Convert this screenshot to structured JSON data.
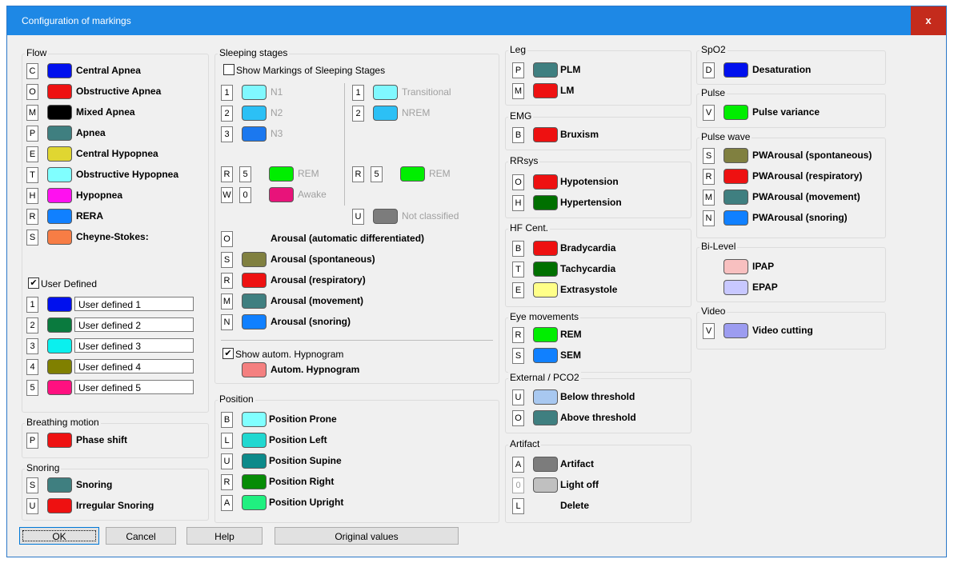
{
  "window": {
    "title": "Configuration of markings",
    "close": "x"
  },
  "colors": {
    "blue": "#0010ee",
    "red": "#ee1111",
    "black": "#000000",
    "teal": "#3f7f80",
    "yellow": "#e0d631",
    "lightcyan": "#80ffff",
    "magenta": "#ff10f0",
    "skyblue": "#1080ff",
    "orange": "#f77d45",
    "darkgreen": "#0a7a3e",
    "cyan": "#0af0ee",
    "olive": "#808000",
    "pink": "#ff1080",
    "n1": "#80f8ff",
    "n2": "#2cc0f5",
    "n3": "#1b78ef",
    "green": "#00ee00",
    "deeppink": "#e8137a",
    "gray": "#7c7c7c",
    "khaki": "#808040",
    "salmon": "#f48080",
    "turquoise": "#20d8d0",
    "darkcyan": "#0c8a8a",
    "green2": "#068c06",
    "springgreen": "#20f080",
    "red2": "#ee1111",
    "darkgreen2": "#007000",
    "lightyellow": "#ffff88",
    "lightblue": "#a8c8f0",
    "lightgray": "#c0c0c0",
    "lightpink": "#f8c0c0",
    "lavender": "#c8c8ff",
    "periwinkle": "#9c9cf0"
  },
  "flow": {
    "caption": "Flow",
    "items": [
      {
        "key": "C",
        "label": "Central Apnea",
        "color": "#0010ee"
      },
      {
        "key": "O",
        "label": "Obstructive Apnea",
        "color": "#ee1111"
      },
      {
        "key": "M",
        "label": "Mixed Apnea",
        "color": "#000000"
      },
      {
        "key": "P",
        "label": "Apnea",
        "color": "#3f7f80"
      },
      {
        "key": "E",
        "label": "Central Hypopnea",
        "color": "#e0d631"
      },
      {
        "key": "T",
        "label": "Obstructive Hypopnea",
        "color": "#80ffff"
      },
      {
        "key": "H",
        "label": "Hypopnea",
        "color": "#ff10f0"
      },
      {
        "key": "R",
        "label": "RERA",
        "color": "#1080ff"
      },
      {
        "key": "S",
        "label": "Cheyne-Stokes:",
        "color": "#f77d45"
      }
    ],
    "user_defined_label": "User Defined",
    "user_defined_check": "✔",
    "user_items": [
      {
        "key": "1",
        "value": "User defined 1",
        "color": "#0010ee"
      },
      {
        "key": "2",
        "value": "User defined 2",
        "color": "#0a7a3e"
      },
      {
        "key": "3",
        "value": "User defined 3",
        "color": "#0af0ee"
      },
      {
        "key": "4",
        "value": "User defined 4",
        "color": "#808000"
      },
      {
        "key": "5",
        "value": "User defined 5",
        "color": "#ff1080"
      }
    ]
  },
  "breathing": {
    "caption": "Breathing motion",
    "items": [
      {
        "key": "P",
        "label": "Phase shift",
        "color": "#ee1111"
      }
    ]
  },
  "snoring": {
    "caption": "Snoring",
    "items": [
      {
        "key": "S",
        "label": "Snoring",
        "color": "#3f7f80"
      },
      {
        "key": "U",
        "label": "Irregular Snoring",
        "color": "#ee1111"
      }
    ]
  },
  "sleeping": {
    "caption": "Sleeping stages",
    "show_label": "Show Markings of Sleeping Stages",
    "left": [
      {
        "key": "1",
        "label": "N1",
        "color": "#80f8ff"
      },
      {
        "key": "2",
        "label": "N2",
        "color": "#2cc0f5"
      },
      {
        "key": "3",
        "label": "N3",
        "color": "#1b78ef"
      }
    ],
    "right": [
      {
        "key": "1",
        "label": "Transitional",
        "color": "#80f8ff"
      },
      {
        "key": "2",
        "label": "NREM",
        "color": "#2cc0f5"
      }
    ],
    "rem_left": {
      "key": "R",
      "num": "5",
      "label": "REM",
      "color": "#00ee00"
    },
    "awake": {
      "key": "W",
      "num": "0",
      "label": "Awake",
      "color": "#e8137a"
    },
    "rem_right": {
      "key": "R",
      "num": "5",
      "label": "REM",
      "color": "#00ee00"
    },
    "not_classified": {
      "key": "U",
      "label": "Not classified",
      "color": "#7c7c7c"
    },
    "arousal_auto": {
      "key": "O",
      "label": "Arousal (automatic differentiated)"
    },
    "arousals": [
      {
        "key": "S",
        "label": "Arousal (spontaneous)",
        "color": "#808040"
      },
      {
        "key": "R",
        "label": "Arousal (respiratory)",
        "color": "#ee1111"
      },
      {
        "key": "M",
        "label": "Arousal (movement)",
        "color": "#3f7f80"
      },
      {
        "key": "N",
        "label": "Arousal (snoring)",
        "color": "#1080ff"
      }
    ],
    "hypnogram_show": "Show autom. Hypnogram",
    "hypnogram_check": "✔",
    "hypnogram_label": "Autom. Hypnogram",
    "hypnogram_color": "#f48080"
  },
  "position": {
    "caption": "Position",
    "items": [
      {
        "key": "B",
        "label": "Position Prone",
        "color": "#80ffff"
      },
      {
        "key": "L",
        "label": "Position Left",
        "color": "#20d8d0"
      },
      {
        "key": "U",
        "label": "Position Supine",
        "color": "#0c8a8a"
      },
      {
        "key": "R",
        "label": "Position Right",
        "color": "#068c06"
      },
      {
        "key": "A",
        "label": "Position Upright",
        "color": "#20f080"
      }
    ]
  },
  "leg": {
    "caption": "Leg",
    "items": [
      {
        "key": "P",
        "label": "PLM",
        "color": "#3f7f80"
      },
      {
        "key": "M",
        "label": "LM",
        "color": "#ee1111"
      }
    ]
  },
  "emg": {
    "caption": "EMG",
    "items": [
      {
        "key": "B",
        "label": "Bruxism",
        "color": "#ee1111"
      }
    ]
  },
  "rrsys": {
    "caption": "RRsys",
    "items": [
      {
        "key": "O",
        "label": "Hypotension",
        "color": "#ee1111"
      },
      {
        "key": "H",
        "label": "Hypertension",
        "color": "#007000"
      }
    ]
  },
  "hf": {
    "caption": "HF Cent.",
    "items": [
      {
        "key": "B",
        "label": "Bradycardia",
        "color": "#ee1111"
      },
      {
        "key": "T",
        "label": "Tachycardia",
        "color": "#007000"
      },
      {
        "key": "E",
        "label": "Extrasystole",
        "color": "#ffff88"
      }
    ]
  },
  "eye": {
    "caption": "Eye movements",
    "items": [
      {
        "key": "R",
        "label": "REM",
        "color": "#00ee00"
      },
      {
        "key": "S",
        "label": "SEM",
        "color": "#1080ff"
      }
    ]
  },
  "external": {
    "caption": "External / PCO2",
    "items": [
      {
        "key": "U",
        "label": "Below threshold",
        "color": "#a8c8f0"
      },
      {
        "key": "O",
        "label": "Above threshold",
        "color": "#3f7f80"
      }
    ]
  },
  "artifact": {
    "caption": "Artifact",
    "items": [
      {
        "key": "A",
        "label": "Artifact",
        "color": "#7c7c7c"
      },
      {
        "key": "0",
        "label": "Light off",
        "color": "#c0c0c0"
      },
      {
        "key": "L",
        "label": "Delete"
      }
    ]
  },
  "spo2": {
    "caption": "SpO2",
    "items": [
      {
        "key": "D",
        "label": "Desaturation",
        "color": "#0010ee"
      }
    ]
  },
  "pulse": {
    "caption": "Pulse",
    "items": [
      {
        "key": "V",
        "label": "Pulse variance",
        "color": "#00ee00"
      }
    ]
  },
  "pulsewave": {
    "caption": "Pulse wave",
    "items": [
      {
        "key": "S",
        "label": "PWArousal (spontaneous)",
        "color": "#808040"
      },
      {
        "key": "R",
        "label": "PWArousal (respiratory)",
        "color": "#ee1111"
      },
      {
        "key": "M",
        "label": "PWArousal (movement)",
        "color": "#3f7f80"
      },
      {
        "key": "N",
        "label": "PWArousal (snoring)",
        "color": "#1080ff"
      }
    ]
  },
  "bilevel": {
    "caption": "Bi-Level",
    "items": [
      {
        "label": "IPAP",
        "color": "#f8c0c0"
      },
      {
        "label": "EPAP",
        "color": "#c8c8ff"
      }
    ]
  },
  "video": {
    "caption": "Video",
    "items": [
      {
        "key": "V",
        "label": "Video cutting",
        "color": "#9c9cf0"
      }
    ]
  },
  "buttons": {
    "ok": "OK",
    "cancel": "Cancel",
    "help": "Help",
    "original": "Original values"
  }
}
